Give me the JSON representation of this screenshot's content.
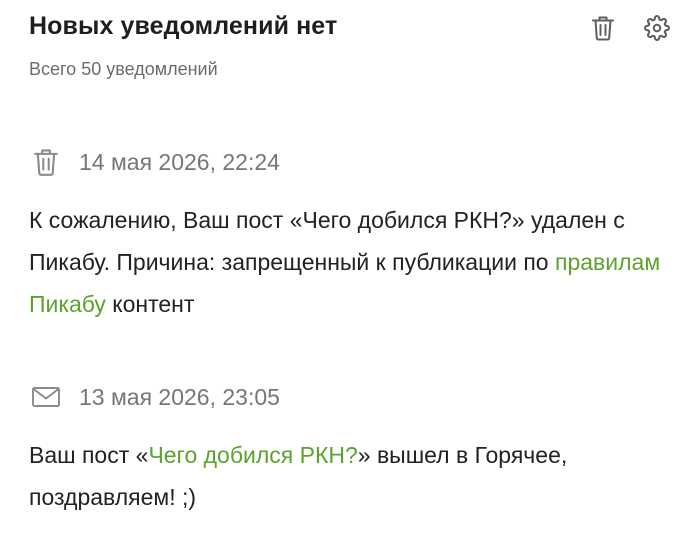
{
  "header": {
    "title": "Новых уведомлений нет",
    "subtitle": "Всего 50 уведомлений",
    "delete_icon": "trash-icon",
    "settings_icon": "gear-icon"
  },
  "notifications": [
    {
      "icon": "trash-icon",
      "date": "14 мая 2026, 22:24",
      "text_before": "К сожалению, Ваш пост «Чего добился РКН?» удален с Пикабу. Причина: запрещенный к публикации по ",
      "link_text": "правилам Пикабу",
      "text_after": " контент"
    },
    {
      "icon": "mail-icon",
      "date": "13 мая 2026, 23:05",
      "text_before": "Ваш пост «",
      "link_text": "Чего добился РКН?",
      "text_after": "» вышел в Горячее, поздравляем! ;)"
    }
  ],
  "colors": {
    "link": "#5ba32c",
    "muted": "#767676",
    "icon": "#8a8a8a"
  }
}
